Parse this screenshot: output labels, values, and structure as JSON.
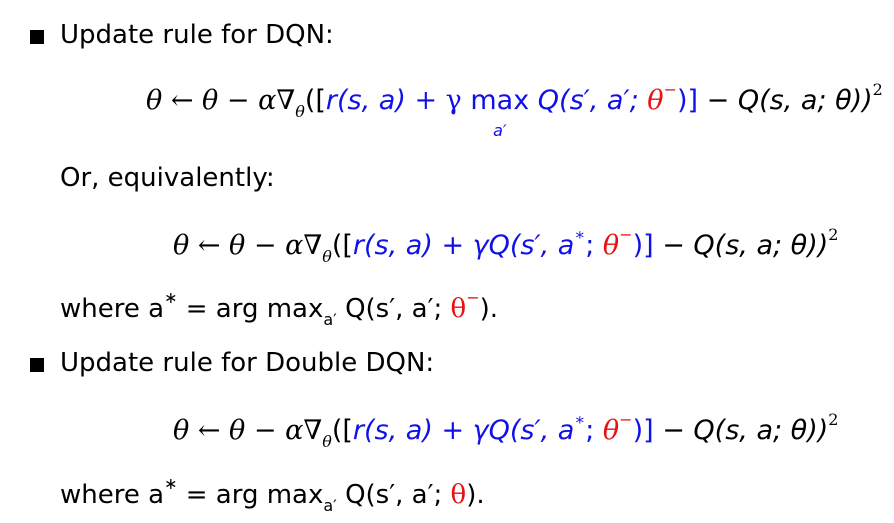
{
  "bullets": [
    {
      "label": "Update rule for DQN:"
    },
    {
      "label": "Update rule for Double DQN:"
    }
  ],
  "connector_text": "Or, equivalently:",
  "equations": {
    "dqn_max": {
      "lhs": "θ ← θ − α∇",
      "grad_sub": "θ",
      "open": "([",
      "reward": "r(s, a)",
      "plus_gamma": " + γ ",
      "max_word": "max",
      "max_under": "a′",
      "q_target": " Q(s′, a′; ",
      "theta_minus": "θ",
      "theta_minus_sup": "−",
      "close_target": ")]",
      "minus_q": " − Q(s, a; θ))",
      "square": "2"
    },
    "dqn_equiv": {
      "lhs": "θ ← θ − α∇",
      "grad_sub": "θ",
      "open": "([",
      "reward": "r(s, a)",
      "plus_gamma_q": " + γQ(s′, a",
      "star": "∗",
      "sep": "; ",
      "theta_minus": "θ",
      "theta_minus_sup": "−",
      "close_target": ")]",
      "minus_q": " − Q(s, a; θ))",
      "square": "2"
    },
    "double_dqn": {
      "lhs": "θ ← θ − α∇",
      "grad_sub": "θ",
      "open": "([",
      "reward": "r(s, a)",
      "plus_gamma_q": " + γQ(s′, a",
      "star": "∗",
      "sep": "; ",
      "theta_minus": "θ",
      "theta_minus_sup": "−",
      "close_target": ")]",
      "minus_q": " − Q(s, a; θ))",
      "square": "2"
    }
  },
  "where_lines": [
    {
      "prefix": "where ",
      "a": "a",
      "star": "∗",
      "eq": " = arg max",
      "sub": "a′",
      "q": " Q(s′, a′; ",
      "theta": "θ",
      "theta_sup": "−",
      "end": ")."
    },
    {
      "prefix": "where ",
      "a": "a",
      "star": "∗",
      "eq": " = arg max",
      "sub": "a′",
      "q": " Q(s′, a′; ",
      "theta": "θ",
      "theta_sup": "",
      "end": ")."
    }
  ],
  "colors": {
    "blue": "#1010e8",
    "red": "#e81010",
    "text": "#000000"
  }
}
